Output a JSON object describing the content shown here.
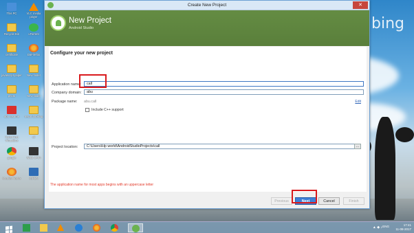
{
  "desktop": {
    "bing_text": "bing",
    "icons": [
      {
        "label": "This PC",
        "kind": "pc"
      },
      {
        "label": "VLC media player",
        "kind": "vlc"
      },
      {
        "label": "Recycle Bin",
        "kind": "folder"
      },
      {
        "label": "uTorrent",
        "kind": "green"
      },
      {
        "label": "certificate",
        "kind": "folder"
      },
      {
        "label": "DaFirefox",
        "kind": "ff"
      },
      {
        "label": "javascript paper",
        "kind": "folder"
      },
      {
        "label": "New folder",
        "kind": "folder"
      },
      {
        "label": "photo",
        "kind": "folder"
      },
      {
        "label": "New folder",
        "kind": "folder"
      },
      {
        "label": "abu resume",
        "kind": "pdf"
      },
      {
        "label": "resort booking",
        "kind": "folder"
      },
      {
        "label": "HyberHost VirtualBox",
        "kind": "dark"
      },
      {
        "label": "cll",
        "kind": "folder"
      },
      {
        "label": "google",
        "kind": "chrome"
      },
      {
        "label": "WSB SF04",
        "kind": "dark"
      },
      {
        "label": "Mozilla Firefox",
        "kind": "ff"
      },
      {
        "label": "IGREN",
        "kind": "mail"
      }
    ]
  },
  "window": {
    "title": "Create New Project",
    "close_label": "✕",
    "banner_title": "New Project",
    "banner_subtitle": "Android Studio",
    "heading": "Configure your new project",
    "fields": {
      "app_name_label": "Application name:",
      "app_name_value": "call",
      "company_label": "Company domain:",
      "company_value": "abu",
      "package_label": "Package name:",
      "package_value": "abu.call",
      "edit_label": "Edit",
      "cpp_label": "Include C++ support",
      "location_label": "Project location:",
      "location_value": "C:\\Users\\Hp world\\AndroidStudioProjects\\call",
      "browse_label": "..."
    },
    "error_text": "The application name for most apps begins with an uppercase letter",
    "buttons": {
      "previous": "Previous",
      "next": "Next",
      "cancel": "Cancel",
      "finish": "Finish"
    }
  },
  "taskbar": {
    "apps": [
      "store-icon",
      "explorer-icon",
      "vlc-icon",
      "ie-icon",
      "firefox-icon",
      "chrome-icon",
      "android-studio-icon"
    ],
    "language": "ENG",
    "time": "17:41",
    "date": "11-08-2017"
  },
  "colors": {
    "accent": "#3e7fd6",
    "banner": "#5b7f3a",
    "error": "#e23a2a",
    "highlight": "#d9191c"
  }
}
